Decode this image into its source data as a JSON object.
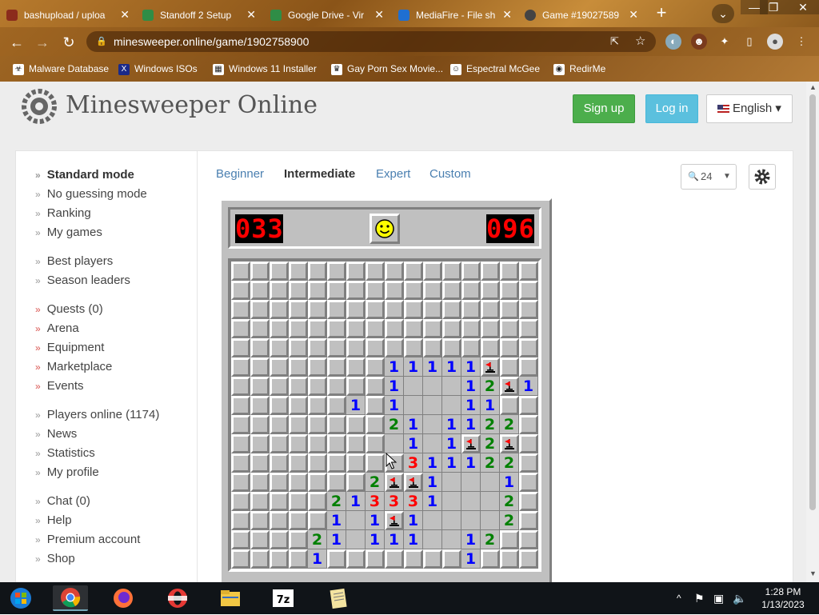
{
  "browser": {
    "tabs": [
      {
        "title": "bashupload / uploa",
        "color": "#8b2b1c"
      },
      {
        "title": "Standoff 2 Setup",
        "color": "#2f8d46"
      },
      {
        "title": "Google Drive - Vir",
        "color": "#2f8d46"
      },
      {
        "title": "MediaFire - File sh",
        "color": "#1f6fd1"
      },
      {
        "title": "Game #19027589",
        "color": "#444444"
      }
    ],
    "new_tab": "+",
    "tab_menu": "⌄",
    "window_controls": [
      "—",
      "❐",
      "✕"
    ],
    "back": "←",
    "forward": "→",
    "reload": "↻",
    "url": "minesweeper.online/game/1902758900",
    "bookmarks": [
      {
        "label": "Malware Database",
        "icon": "☣"
      },
      {
        "label": "Windows ISOs",
        "icon": "X"
      },
      {
        "label": "Windows 11 Installer",
        "icon": "▦"
      },
      {
        "label": "Gay Porn Sex Movie...",
        "icon": "♛"
      },
      {
        "label": "Espectral McGee",
        "icon": "☺"
      },
      {
        "label": "RedirMe",
        "icon": "◉"
      }
    ]
  },
  "site": {
    "logo_text": "Minesweeper Online",
    "signup": "Sign up",
    "login": "Log in",
    "language": "English",
    "lang_caret": "▾"
  },
  "sidebar": {
    "groups": [
      [
        {
          "label": "Standard mode",
          "bold": true
        },
        {
          "label": "No guessing mode"
        },
        {
          "label": "Ranking"
        },
        {
          "label": "My games"
        }
      ],
      [
        {
          "label": "Best players"
        },
        {
          "label": "Season leaders"
        }
      ],
      [
        {
          "label": "Quests (0)",
          "red": true
        },
        {
          "label": "Arena",
          "red": true
        },
        {
          "label": "Equipment",
          "red": true
        },
        {
          "label": "Marketplace",
          "red": true
        },
        {
          "label": "Events",
          "red": true
        }
      ],
      [
        {
          "label": "Players online (1174)"
        },
        {
          "label": "News"
        },
        {
          "label": "Statistics"
        },
        {
          "label": "My profile"
        }
      ],
      [
        {
          "label": "Chat (0)"
        },
        {
          "label": "Help"
        },
        {
          "label": "Premium account"
        },
        {
          "label": "Shop"
        }
      ]
    ],
    "chevron": "»"
  },
  "modes": {
    "items": [
      "Beginner",
      "Intermediate",
      "Expert",
      "Custom"
    ],
    "selected": "Intermediate"
  },
  "zoom": {
    "value": "24",
    "icon": "magnifier-icon"
  },
  "game": {
    "mines_left": "033",
    "timer": "096",
    "face": "smile",
    "board": [
      "################",
      "################",
      "################",
      "################",
      "################",
      "########11111F##",
      "########1...12F1",
      "######1#1...11##",
      "########21.1122#",
      "########.1.1F2F#",
      "#########311122#",
      "#######2FF1...1#",
      "#####213331...2#",
      "#####1.1F1....2#",
      "####21.111..12##",
      "####1#######1###"
    ]
  },
  "taskbar": {
    "apps": [
      "start-icon",
      "chrome-icon",
      "firefox-icon",
      "opera-icon",
      "file-explorer-icon",
      "7zip-icon",
      "notepad-icon"
    ],
    "tray_arrow": "^",
    "time": "1:28 PM",
    "date": "1/13/2023"
  },
  "colors": {
    "n1": "#0000ff",
    "n2": "#008000",
    "n3": "#ff0000",
    "signup": "#4cae4c",
    "login": "#5bc0de",
    "counter": "#ff0000"
  }
}
